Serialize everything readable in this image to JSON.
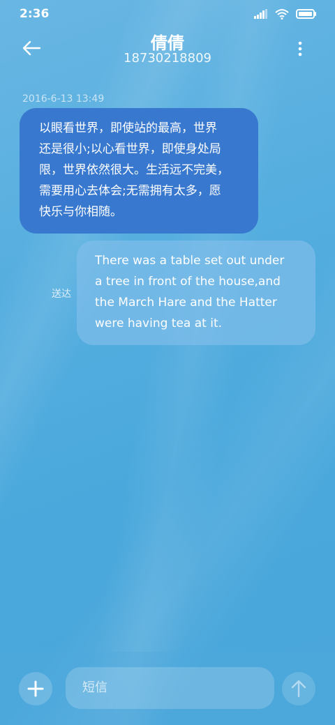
{
  "status_bar": {
    "time": "2:36"
  },
  "header": {
    "title": "倩倩",
    "subtitle": "18730218809"
  },
  "messages": [
    {
      "timestamp": "2016-6-13 13:49",
      "lines": [
        "以眼看世界，即使站的最高，世界",
        "还是很小;以心看世界，即使身处局",
        "限，世界依然很大。生活远不完美，",
        "需要用心去体会;无需拥有太多，愿",
        "快乐与你相随。"
      ]
    },
    {
      "status": "送达",
      "lines": [
        "There was a table set out under",
        "a tree in front of the house,and",
        "the March Hare and the Hatter",
        "were having tea at it."
      ]
    }
  ],
  "input": {
    "placeholder": "短信"
  },
  "colors": {
    "incoming_bubble": "#3879cf",
    "outgoing_bubble": "#7fbde9",
    "background": "#4aa8dc"
  }
}
